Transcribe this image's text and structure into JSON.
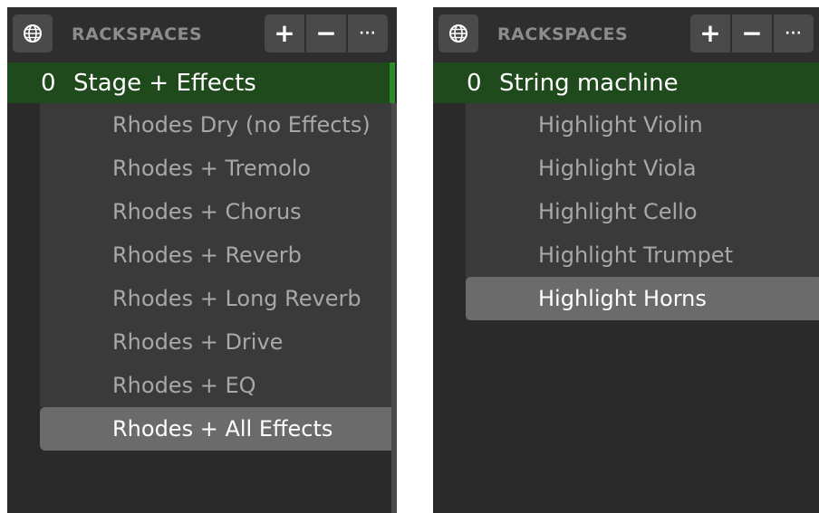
{
  "panels": [
    {
      "header": {
        "title": "RACKSPACES",
        "globe_icon": "globe-icon",
        "add_label": "+",
        "remove_label": "−",
        "more_label": "···"
      },
      "rackspace": {
        "index": "0",
        "name": "Stage + Effects"
      },
      "variations": [
        "Rhodes Dry (no Effects)",
        "Rhodes + Tremolo",
        "Rhodes + Chorus",
        "Rhodes + Reverb",
        "Rhodes + Long Reverb",
        "Rhodes + Drive",
        "Rhodes + EQ",
        "Rhodes + All Effects"
      ],
      "selected_variation": "Rhodes + All Effects"
    },
    {
      "header": {
        "title": "RACKSPACES",
        "globe_icon": "globe-icon",
        "add_label": "+",
        "remove_label": "−",
        "more_label": "···"
      },
      "rackspace": {
        "index": "0",
        "name": "String machine"
      },
      "variations": [
        "Highlight Violin",
        "Highlight Viola",
        "Highlight Cello",
        "Highlight Trumpet",
        "Highlight Horns"
      ],
      "selected_variation": "Highlight Horns"
    }
  ],
  "colors": {
    "panel_bg": "#2a2a2a",
    "rack_selected_bg": "#1e4a1c",
    "rack_accent": "#2f8a28",
    "variation_bg": "#3a3a3a",
    "variation_selected_bg": "#6b6b6b"
  }
}
